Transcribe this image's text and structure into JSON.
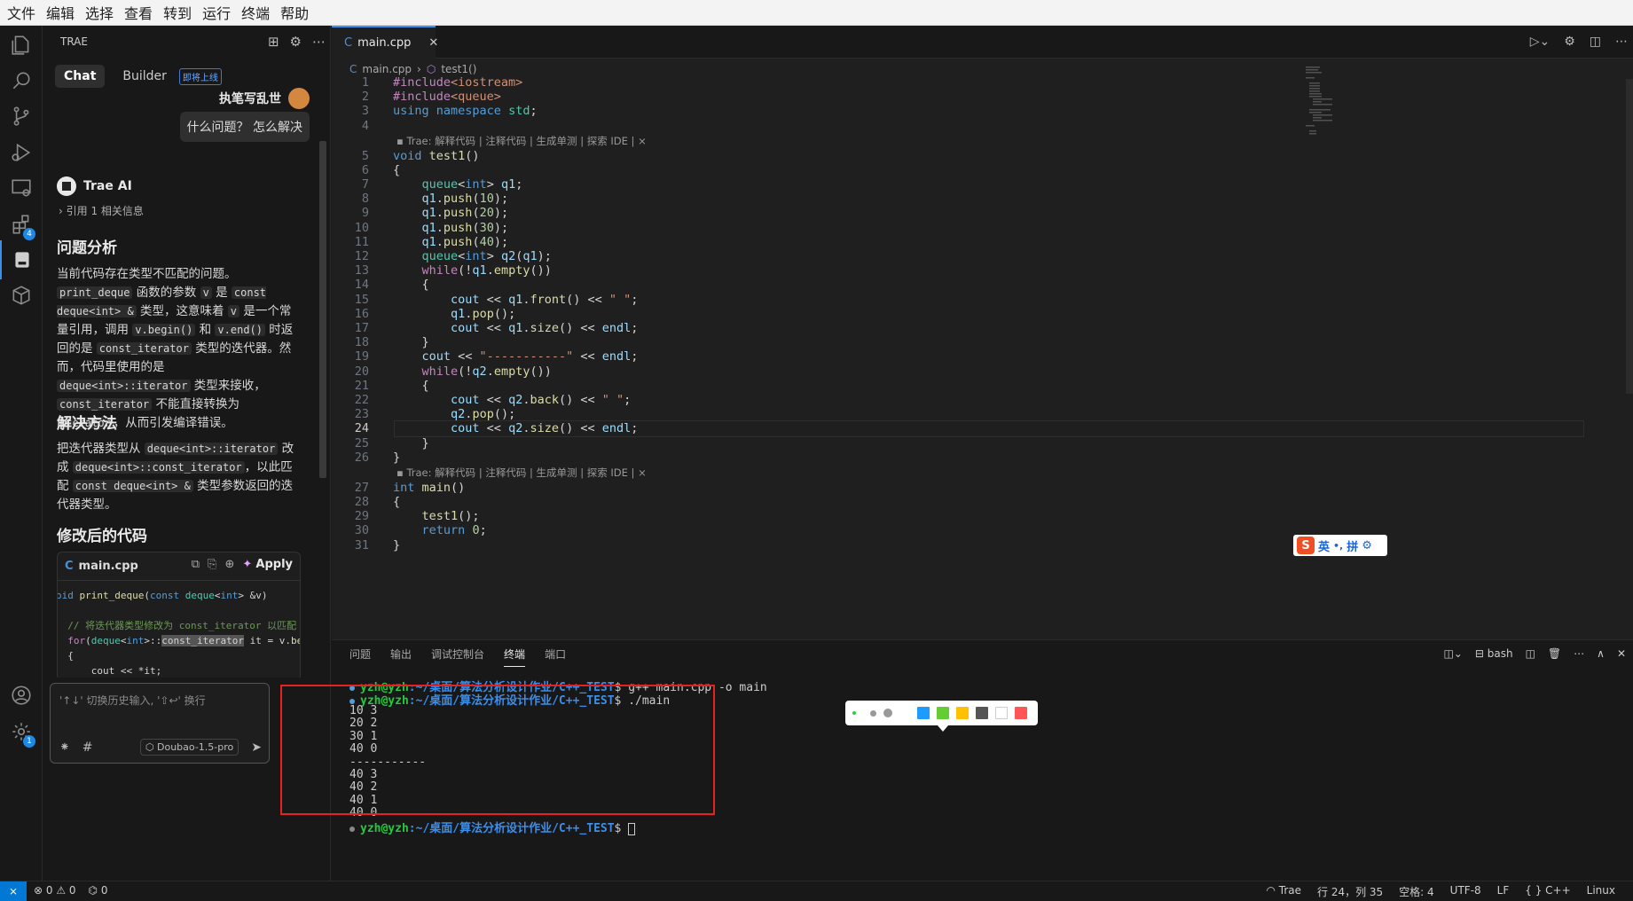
{
  "menu": [
    "文件",
    "编辑",
    "选择",
    "查看",
    "转到",
    "运行",
    "终端",
    "帮助"
  ],
  "activity_badges": {
    "extensions": "4",
    "settings": "1"
  },
  "chat": {
    "panel_title": "TRAE",
    "tabs": [
      "Chat",
      "Builder"
    ],
    "builder_badge": "即将上线",
    "user_name": "执笔写乱世",
    "user_message": "什么问题？ 怎么解决",
    "ai_name": "Trae AI",
    "ref_info": "引用 1 相关信息",
    "h_problem": "问题分析",
    "p1": [
      {
        "t": "当前代码存在类型不匹配的问题。"
      },
      {
        "c": "print_deque"
      },
      {
        "t": " 函数的参数 "
      },
      {
        "c": "v"
      },
      {
        "t": " 是 "
      },
      {
        "c": "const deque<int> &"
      },
      {
        "t": " 类型，这意味着 "
      },
      {
        "c": "v"
      },
      {
        "t": " 是一个常量引用，调用 "
      },
      {
        "c": "v.begin()"
      },
      {
        "t": " 和 "
      },
      {
        "c": "v.end()"
      },
      {
        "t": " 时返回的是 "
      },
      {
        "c": "const_iterator"
      },
      {
        "t": " 类型的迭代器。然而，代码里使用的是 "
      },
      {
        "c": "deque<int>::iterator"
      },
      {
        "t": " 类型来接收， "
      },
      {
        "c": "const_iterator"
      },
      {
        "t": " 不能直接转换为 "
      },
      {
        "c": "iterator"
      },
      {
        "t": "，从而引发编译错误。"
      }
    ],
    "h_solution": "解决方法",
    "p2": [
      {
        "t": "把迭代器类型从 "
      },
      {
        "c": "deque<int>::iterator"
      },
      {
        "t": " 改成 "
      },
      {
        "c": "deque<int>::const_iterator"
      },
      {
        "t": "，以此匹配 "
      },
      {
        "c": "const deque<int> &"
      },
      {
        "t": " 类型参数返回的迭代器类型。"
      }
    ],
    "h_code": "修改后的代码",
    "code_file": "main.cpp",
    "apply_label": "Apply",
    "code_lines": [
      "oid print_deque(const deque<int> &v)",
      "",
      "  // 将迭代器类型修改为 const_iterator 以匹配",
      "  for(deque<int>::const_iterator it = v.begin",
      "  {",
      "      cout << *it;"
    ],
    "input_placeholder": "'↑↓' 切换历史输入, '⇧↩' 换行",
    "model": "Doubao-1.5-pro"
  },
  "editor": {
    "tab": "main.cpp",
    "breadcrumb": [
      "main.cpp",
      "test1()"
    ],
    "codelens": "Trae: 解释代码 | 注释代码 | 生成单测 | 探索 IDE | ×",
    "current_line": 24,
    "lines": [
      "#include<iostream>",
      "#include<queue>",
      "using namespace std;",
      "",
      "void test1()",
      "{",
      "    queue<int> q1;",
      "    q1.push(10);",
      "    q1.push(20);",
      "    q1.push(30);",
      "    q1.push(40);",
      "    queue<int> q2(q1);",
      "    while(!q1.empty())",
      "    {",
      "        cout << q1.front() << \" \";",
      "        q1.pop();",
      "        cout << q1.size() << endl;",
      "    }",
      "    cout << \"-----------\" << endl;",
      "    while(!q2.empty())",
      "    {",
      "        cout << q2.back() << \" \";",
      "        q2.pop();",
      "        cout << q2.size() << endl;",
      "    }",
      "}",
      "int main()",
      "{",
      "    test1();",
      "    return 0;",
      "}"
    ]
  },
  "panel": {
    "tabs": [
      "问题",
      "输出",
      "调试控制台",
      "终端",
      "端口"
    ],
    "active_tab": "终端",
    "shell": "bash",
    "prompt_user": "yzh@yzh",
    "prompt_path": ":~/桌面/算法分析设计作业/C++_TEST",
    "cmd1": "$ g++ main.cpp -o main",
    "cmd2": "$ ./main",
    "output": [
      "10 3",
      "20 2",
      "30 1",
      "40 0",
      "-----------",
      "40 3",
      "40 2",
      "40 1",
      "40 0"
    ],
    "prompt_end": "$ "
  },
  "palette_colors": [
    "#1e9bff",
    "#66cc33",
    "#ffc000",
    "#555555",
    "#ffffff",
    "#ff5555"
  ],
  "ime": {
    "mode": "英",
    "punct": "•,",
    "pinyin": "拼"
  },
  "status": {
    "errors": "0",
    "warnings": "0",
    "ports": "0",
    "trae": "Trae",
    "position": "行 24，列 35",
    "spaces": "空格: 4",
    "encoding": "UTF-8",
    "eol": "LF",
    "language": "C++",
    "os": "Linux"
  }
}
